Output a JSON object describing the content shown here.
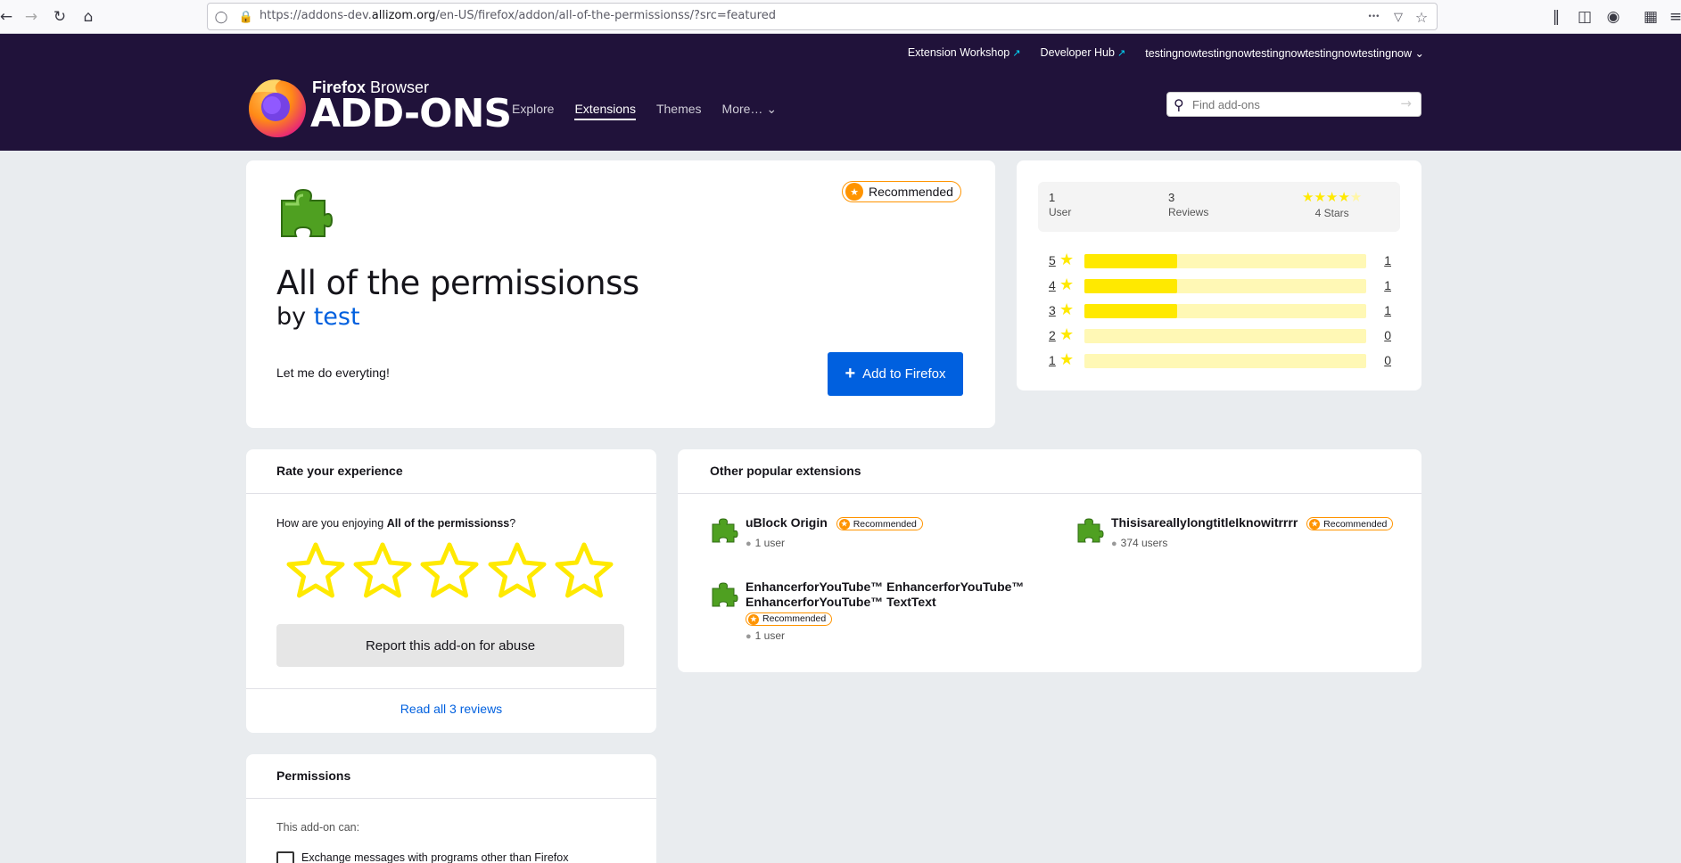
{
  "browser": {
    "url_prefix": "https://addons-dev.",
    "url_domain": "allizom.org",
    "url_path": "/en-US/firefox/addon/all-of-the-permissionss/?src=featured",
    "page_actions_icon": "•••"
  },
  "header": {
    "top_links": [
      "Extension Workshop",
      "Developer Hub"
    ],
    "username": "testingnowtestingnowtestingnowtestingnowtestingnow",
    "logo_top_bold": "Firefox",
    "logo_top_rest": " Browser",
    "logo_main": "ADD-ONS",
    "nav": [
      "Explore",
      "Extensions",
      "Themes",
      "More…"
    ],
    "search_placeholder": "Find add-ons"
  },
  "addon": {
    "badge": "Recommended",
    "name": "All of the permissionss",
    "by": "by ",
    "author": "test",
    "description": "Let me do everyting!",
    "install_label": "Add to Firefox"
  },
  "ratings": {
    "users_count": "1",
    "users_label": "User",
    "reviews_count": "3",
    "reviews_label": "Reviews",
    "stars_label": "4 Stars",
    "average": 4,
    "bars": [
      {
        "stars": "5",
        "count": "1",
        "fraction": 0.33
      },
      {
        "stars": "4",
        "count": "1",
        "fraction": 0.33
      },
      {
        "stars": "3",
        "count": "1",
        "fraction": 0.33
      },
      {
        "stars": "2",
        "count": "0",
        "fraction": 0
      },
      {
        "stars": "1",
        "count": "0",
        "fraction": 0
      }
    ]
  },
  "rate": {
    "title": "Rate your experience",
    "question_prefix": "How are you enjoying ",
    "question_addon": "All of the permissionss",
    "question_suffix": "?",
    "report_label": "Report this add-on for abuse",
    "read_all_label": "Read all 3 reviews"
  },
  "popular": {
    "title": "Other popular extensions",
    "items": [
      {
        "name": "uBlock Origin",
        "badge": "Recommended",
        "users": "1 user"
      },
      {
        "name": "ThisisareallylongtitleIknowitrrrr",
        "badge": "Recommended",
        "users": "374 users"
      },
      {
        "name_line1": "EnhancerforYouTube™ EnhancerforYouTube™",
        "name_line2": "EnhancerforYouTube™ TextText",
        "badge": "Recommended",
        "users": "1 user"
      }
    ]
  },
  "permissions": {
    "title": "Permissions",
    "subtitle": "This add-on can:",
    "items": [
      "Exchange messages with programs other than Firefox"
    ]
  },
  "colors": {
    "header_bg": "#20123a",
    "accent_blue": "#0060df",
    "star_yellow": "#ffe900",
    "badge_orange": "#ff9400"
  }
}
